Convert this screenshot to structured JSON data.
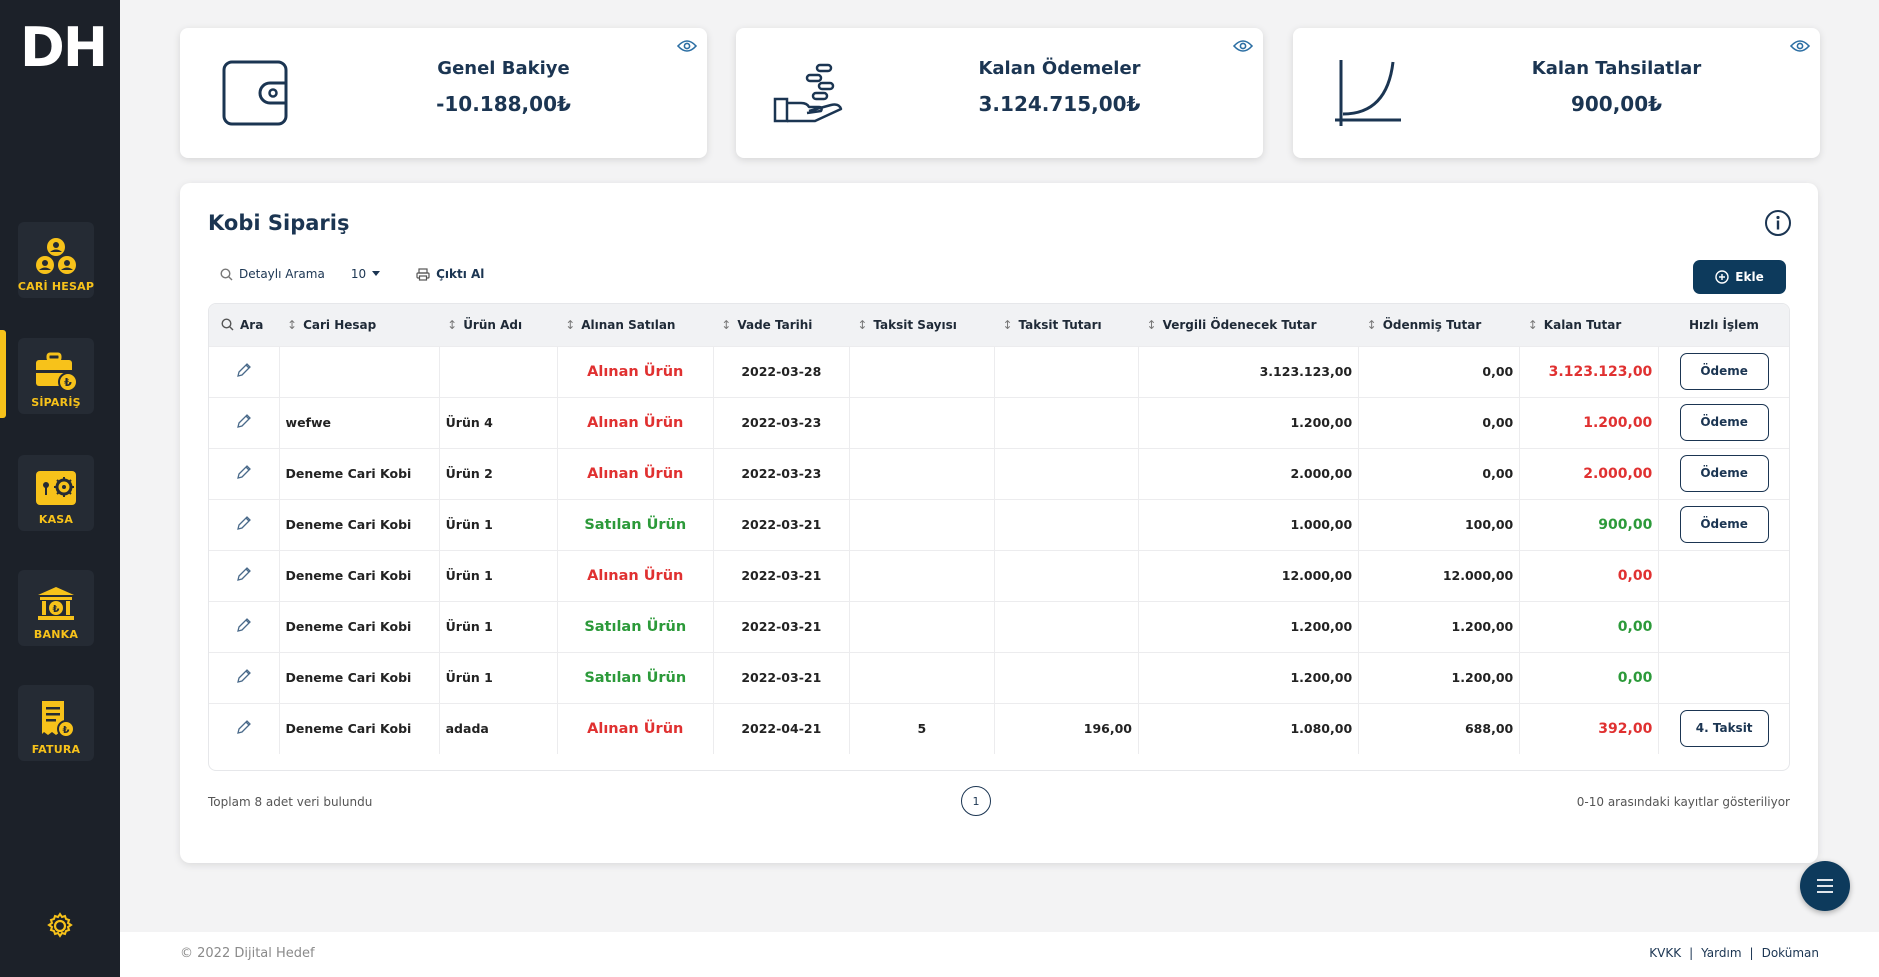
{
  "brand": {
    "logo": "DH"
  },
  "sidebar": {
    "items": [
      {
        "label": "CARİ HESAP",
        "icon": "users-group-icon"
      },
      {
        "label": "SİPARİŞ",
        "icon": "briefcase-lira-icon",
        "active": true
      },
      {
        "label": "KASA",
        "icon": "safe-icon"
      },
      {
        "label": "BANKA",
        "icon": "bank-icon"
      },
      {
        "label": "FATURA",
        "icon": "invoice-icon"
      }
    ],
    "settings_icon": "gear-icon"
  },
  "cards": [
    {
      "title": "Genel Bakiye",
      "value": "-10.188,00₺",
      "icon": "wallet-icon"
    },
    {
      "title": "Kalan Ödemeler",
      "value": "3.124.715,00₺",
      "icon": "hand-coins-icon"
    },
    {
      "title": "Kalan Tahsilatlar",
      "value": "900,00₺",
      "icon": "growth-curve-icon"
    }
  ],
  "panel": {
    "title": "Kobi Sipariş",
    "toolbar": {
      "search_label": "Detaylı Arama",
      "page_size": "10",
      "print_label": "Çıktı Al"
    },
    "add_label": "Ekle",
    "columns": [
      "Ara",
      "Cari Hesap",
      "Ürün Adı",
      "Alınan Satılan",
      "Vade Tarihi",
      "Taksit Sayısı",
      "Taksit Tutarı",
      "Vergili Ödenecek Tutar",
      "Ödenmiş Tutar",
      "Kalan Tutar",
      "Hızlı İşlem"
    ],
    "rows": [
      {
        "cari": "",
        "urun": "",
        "tip": "Alınan Ürün",
        "vade": "2022-03-28",
        "taksit_sayisi": "",
        "taksit_tutari": "",
        "vergili": "3.123.123,00",
        "odenmis": "0,00",
        "kalan": "3.123.123,00",
        "action": "Ödeme"
      },
      {
        "cari": "wefwe",
        "urun": "Ürün 4",
        "tip": "Alınan Ürün",
        "vade": "2022-03-23",
        "taksit_sayisi": "",
        "taksit_tutari": "",
        "vergili": "1.200,00",
        "odenmis": "0,00",
        "kalan": "1.200,00",
        "action": "Ödeme"
      },
      {
        "cari": "Deneme Cari Kobi",
        "urun": "Ürün 2",
        "tip": "Alınan Ürün",
        "vade": "2022-03-23",
        "taksit_sayisi": "",
        "taksit_tutari": "",
        "vergili": "2.000,00",
        "odenmis": "0,00",
        "kalan": "2.000,00",
        "action": "Ödeme"
      },
      {
        "cari": "Deneme Cari Kobi",
        "urun": "Ürün 1",
        "tip": "Satılan Ürün",
        "vade": "2022-03-21",
        "taksit_sayisi": "",
        "taksit_tutari": "",
        "vergili": "1.000,00",
        "odenmis": "100,00",
        "kalan": "900,00",
        "action": "Ödeme"
      },
      {
        "cari": "Deneme Cari Kobi",
        "urun": "Ürün 1",
        "tip": "Alınan Ürün",
        "vade": "2022-03-21",
        "taksit_sayisi": "",
        "taksit_tutari": "",
        "vergili": "12.000,00",
        "odenmis": "12.000,00",
        "kalan": "0,00",
        "action": ""
      },
      {
        "cari": "Deneme Cari Kobi",
        "urun": "Ürün 1",
        "tip": "Satılan Ürün",
        "vade": "2022-03-21",
        "taksit_sayisi": "",
        "taksit_tutari": "",
        "vergili": "1.200,00",
        "odenmis": "1.200,00",
        "kalan": "0,00",
        "action": ""
      },
      {
        "cari": "Deneme Cari Kobi",
        "urun": "Ürün 1",
        "tip": "Satılan Ürün",
        "vade": "2022-03-21",
        "taksit_sayisi": "",
        "taksit_tutari": "",
        "vergili": "1.200,00",
        "odenmis": "1.200,00",
        "kalan": "0,00",
        "action": ""
      },
      {
        "cari": "Deneme Cari Kobi",
        "urun": "adada",
        "tip": "Alınan Ürün",
        "vade": "2022-04-21",
        "taksit_sayisi": "5",
        "taksit_tutari": "196,00",
        "vergili": "1.080,00",
        "odenmis": "688,00",
        "kalan": "392,00",
        "action": "4. Taksit"
      }
    ],
    "total_text": "Toplam 8 adet veri bulundu",
    "current_page": "1",
    "range_text": "0-10 arasındaki kayıtlar gösteriliyor"
  },
  "colors": {
    "sidebar_bg": "#1c2129",
    "accent_yellow": "#f7c21a",
    "navy": "#1b3552",
    "red": "#e03131",
    "green": "#2c9a3a"
  },
  "footer": {
    "copyright": "© 2022 Dijital Hedef",
    "links": [
      "KVKK",
      "Yardım",
      "Doküman"
    ]
  }
}
